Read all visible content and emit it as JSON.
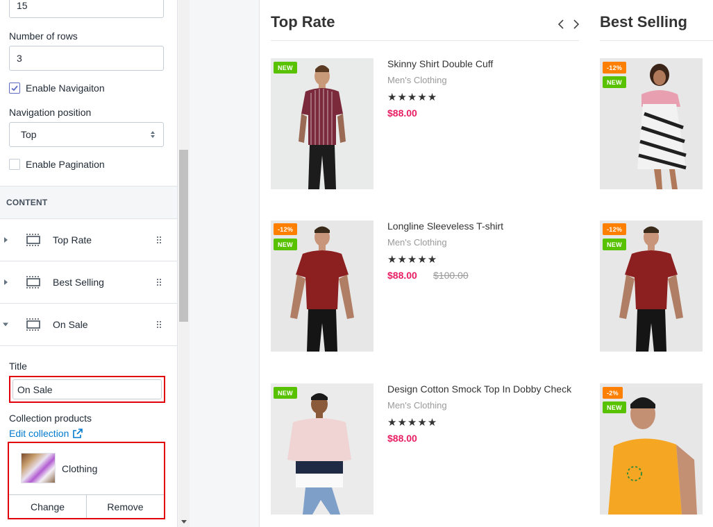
{
  "editor": {
    "items_value": "15",
    "rows_label": "Number of rows",
    "rows_value": "3",
    "enable_navigation_label": "Enable Navigaiton",
    "enable_navigation_checked": true,
    "nav_position_label": "Navigation position",
    "nav_position_value": "Top",
    "enable_pagination_label": "Enable Pagination",
    "enable_pagination_checked": false,
    "content_heading": "CONTENT",
    "blocks": [
      {
        "label": "Top Rate",
        "expanded": false
      },
      {
        "label": "Best Selling",
        "expanded": false
      },
      {
        "label": "On Sale",
        "expanded": true
      }
    ],
    "title_label": "Title",
    "title_value": "On Sale",
    "collection_label": "Collection products",
    "edit_collection_link": "Edit collection",
    "collection_name": "Clothing",
    "change_button": "Change",
    "remove_button": "Remove"
  },
  "preview": {
    "columns": [
      {
        "title": "Top Rate"
      },
      {
        "title": "Best Selling"
      }
    ],
    "top_rate_products": [
      {
        "name": "Skinny Shirt Double Cuff",
        "category": "Men's Clothing",
        "stars": "★★★★★",
        "price": "$88.00",
        "old_price": "",
        "badges": [
          "NEW"
        ]
      },
      {
        "name": "Longline Sleeveless T-shirt",
        "category": "Men's Clothing",
        "stars": "★★★★★",
        "price": "$88.00",
        "old_price": "$100.00",
        "badges": [
          "-12%",
          "NEW"
        ]
      },
      {
        "name": "Design Cotton Smock Top In Dobby Check",
        "category": "Men's Clothing",
        "stars": "★★★★★",
        "price": "$88.00",
        "old_price": "",
        "badges": [
          "NEW"
        ]
      }
    ],
    "best_selling_badges": [
      [
        "-12%",
        "NEW"
      ],
      [
        "-12%",
        "NEW"
      ],
      [
        "-2%",
        "NEW"
      ]
    ]
  },
  "colors": {
    "price": "#e91e63",
    "badge_new": "#59c200",
    "badge_sale": "#ff7f00",
    "highlight_border": "#e0000b",
    "link": "#007ace"
  },
  "icons": [
    "section-block-icon",
    "drag-handle-icon",
    "external-link-icon",
    "chevron-left-icon",
    "chevron-right-icon",
    "checkmark-icon",
    "select-arrows-icon",
    "caret-right-icon",
    "caret-down-icon"
  ]
}
